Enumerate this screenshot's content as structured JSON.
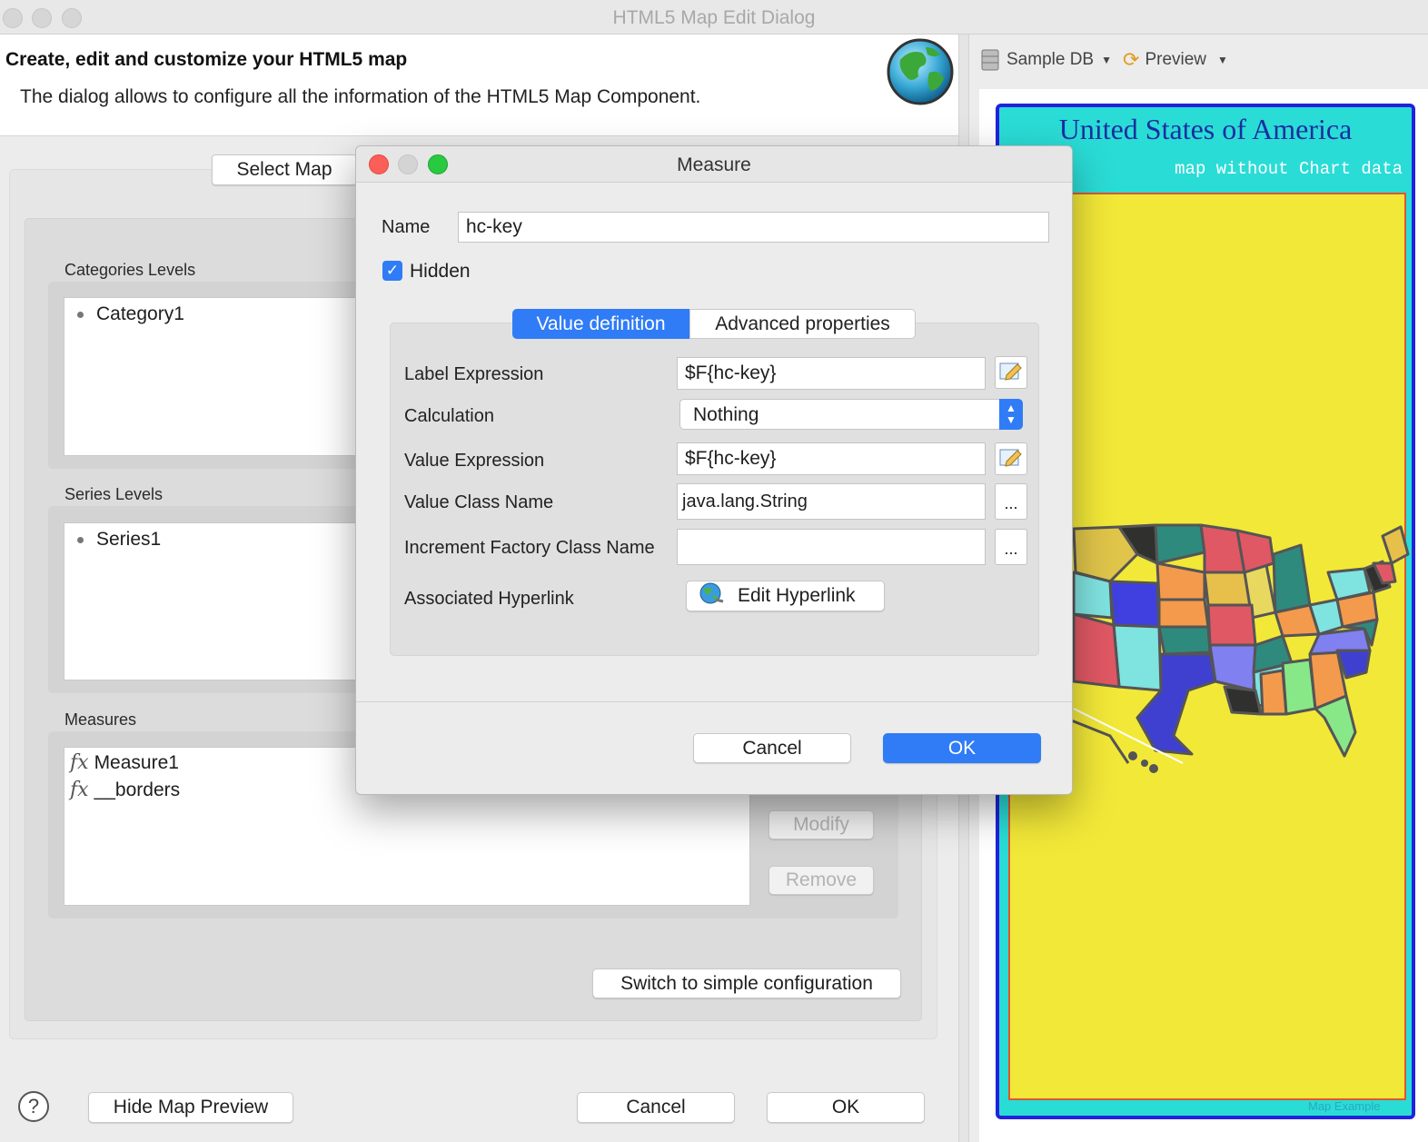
{
  "window": {
    "title": "HTML5 Map Edit Dialog"
  },
  "header": {
    "title": "Create, edit and customize your HTML5 map",
    "subtitle": "The dialog allows to configure all the information of the HTML5 Map Component."
  },
  "left": {
    "select_map_label": "Select Map",
    "categories_label": "Categories Levels",
    "categories": [
      "Category1"
    ],
    "series_label": "Series Levels",
    "series": [
      "Series1"
    ],
    "measures_label": "Measures",
    "measures": [
      {
        "icon": "fx",
        "label": "Measure1"
      },
      {
        "icon": "fx",
        "label": "__borders"
      }
    ],
    "modify_label": "Modify",
    "remove_label": "Remove",
    "switch_label": "Switch to simple configuration"
  },
  "footer": {
    "help": "?",
    "hide_preview_label": "Hide Map Preview",
    "cancel_label": "Cancel",
    "ok_label": "OK"
  },
  "preview_toolbar": {
    "datasource_label": "Sample DB",
    "preview_label": "Preview"
  },
  "preview": {
    "title": "United States of America",
    "subtitle": "map without Chart data",
    "credit": "Map Example",
    "colors": {
      "frame": "#2222dd",
      "background": "#2adcd6",
      "plot": "#f2e838",
      "plot_border": "#e0562e"
    }
  },
  "measure_dialog": {
    "title": "Measure",
    "name_label": "Name",
    "name_value": "hc-key",
    "hidden_label": "Hidden",
    "hidden_checked": true,
    "tabs": [
      {
        "label": "Value definition",
        "active": true
      },
      {
        "label": "Advanced properties",
        "active": false
      }
    ],
    "label_expression_label": "Label Expression",
    "label_expression_value": "$F{hc-key}",
    "calculation_label": "Calculation",
    "calculation_value": "Nothing",
    "value_expression_label": "Value Expression",
    "value_expression_value": "$F{hc-key}",
    "value_class_label": "Value Class Name",
    "value_class_value": "java.lang.String",
    "increment_factory_label": "Increment Factory Class Name",
    "increment_factory_value": "",
    "browse_label": "...",
    "hyperlink_label": "Associated Hyperlink",
    "edit_hyperlink_label": "Edit Hyperlink",
    "cancel_label": "Cancel",
    "ok_label": "OK",
    "accent": "#2f7cf6"
  }
}
